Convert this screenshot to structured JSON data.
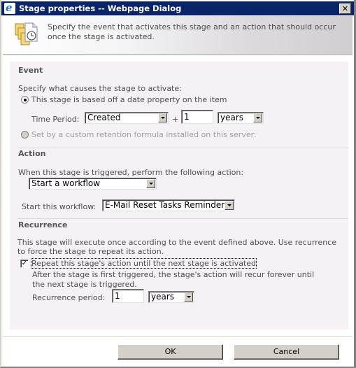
{
  "window": {
    "title": "Stage properties -- Webpage Dialog",
    "close_label": "✕"
  },
  "header": {
    "icon": "document-clock-icon",
    "description": "Specify the event that activates this stage and an action that should occur once the stage is activated."
  },
  "event": {
    "title": "Event",
    "prompt": "Specify what causes the stage to activate:",
    "option_date": {
      "label": "This stage is based off a date property on the item",
      "checked": true
    },
    "time_period_label": "Time Period:",
    "time_period_field": "Created",
    "plus": "+",
    "time_period_amount": "1",
    "time_period_unit": "years",
    "option_formula": {
      "label": "Set by a custom retention formula installed on this server:",
      "checked": false,
      "disabled": true
    }
  },
  "action": {
    "title": "Action",
    "prompt": "When this stage is triggered, perform the following action:",
    "action_value": "Start a workflow",
    "workflow_label": "Start this workflow:",
    "workflow_value": "E-Mail Reset Tasks Reminder"
  },
  "recurrence": {
    "title": "Recurrence",
    "description_line1": "This stage will execute once according to the event defined above. Use recurrence",
    "description_line2": "to force the stage to repeat its action.",
    "repeat_label": "Repeat this stage's action until the next stage is activated",
    "repeat_checked": true,
    "repeat_help_line1": "After the stage is first triggered, the stage's action will recur forever until",
    "repeat_help_line2": "the next stage is triggered.",
    "period_label": "Recurrence period:",
    "period_amount": "1",
    "period_unit": "years"
  },
  "footer": {
    "ok_label": "OK",
    "cancel_label": "Cancel"
  },
  "colors": {
    "titlebar": "#0a246a",
    "panel_background": "#f5f1f5",
    "button_face": "#d4d0c8"
  }
}
